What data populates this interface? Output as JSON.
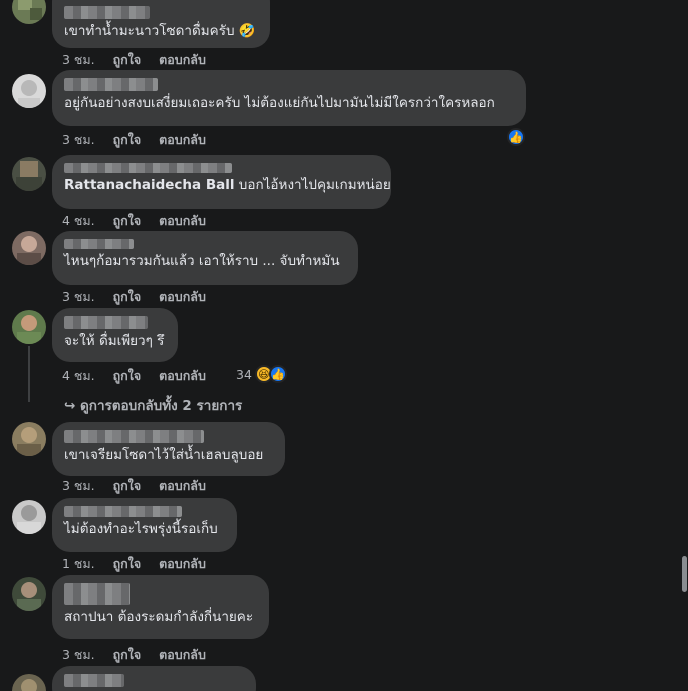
{
  "comments": [
    {
      "text": "เขาทำน้ำมะนาวโซดาดื่มครับ 🤣",
      "time": "3 ชม.",
      "like": "ถูกใจ",
      "reply": "ตอบกลับ"
    },
    {
      "text": "อยู่กันอย่างสงบเสงี่ยมเถอะครับ ไม่ต้องแย่กันไปมามันไม่มีใครกว่าใครหลอก",
      "time": "3 ชม.",
      "like": "ถูกใจ",
      "reply": "ตอบกลับ",
      "reaction_icons": [
        "like-icon"
      ]
    },
    {
      "mention": "Rattanachaidecha Ball",
      "text": " บอกไอ้หงาไปคุมเกมหน่อย",
      "time": "4 ชม.",
      "like": "ถูกใจ",
      "reply": "ตอบกลับ"
    },
    {
      "text": "ไหนๆก้อมารวมกันแล้ว เอาให้ราบ ... จับทำหมัน",
      "time": "3 ชม.",
      "like": "ถูกใจ",
      "reply": "ตอบกลับ"
    },
    {
      "text": "จะให้ ดื่มเพียวๆ รึ",
      "time": "4 ชม.",
      "like": "ถูกใจ",
      "reply": "ตอบกลับ",
      "reaction_count": "34",
      "reaction_icons": [
        "haha-icon",
        "like-icon"
      ],
      "view_replies": "↪ ดูการตอบกลับทั้ง 2 รายการ"
    },
    {
      "text": "เขาเจรียมโซดาไว้ใส่น้ำเฮลบลูบอย",
      "time": "3 ชม.",
      "like": "ถูกใจ",
      "reply": "ตอบกลับ"
    },
    {
      "text": "ไม่ต้องทำอะไรพรุ่งนี้รอเก็บ",
      "time": "1 ชม.",
      "like": "ถูกใจ",
      "reply": "ตอบกลับ"
    },
    {
      "text": "สถาปนา ต้องระดมกำลังกี่นายคะ",
      "time": "3 ชม.",
      "like": "ถูกใจ",
      "reply": "ตอบกลับ"
    }
  ],
  "colors": {
    "background": "#18191a",
    "bubble": "#3a3b3c",
    "text": "#e4e6eb",
    "meta": "#b0b3b8",
    "like_blue": "#1877f2",
    "haha_yellow": "#f7b928"
  }
}
